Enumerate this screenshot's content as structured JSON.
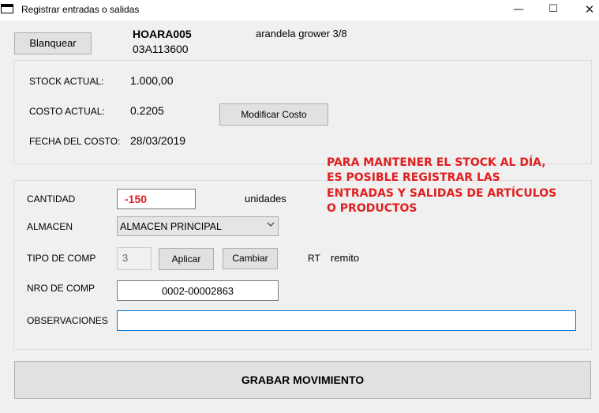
{
  "window": {
    "title": "Registrar entradas o salidas",
    "minimize_glyph": "—",
    "maximize_glyph": "☐",
    "close_glyph": "✕"
  },
  "header": {
    "clear_button": "Blanquear",
    "code": "HOARA005",
    "subcode": "03A113600",
    "description": "arandela grower 3/8"
  },
  "stock": {
    "stock_label": "STOCK ACTUAL:",
    "stock_value": "1.000,00",
    "cost_label": "COSTO ACTUAL:",
    "cost_value": "0.2205",
    "modify_cost_button": "Modificar Costo",
    "cost_date_label": "FECHA DEL COSTO:",
    "cost_date_value": "28/03/2019"
  },
  "notice": {
    "lines": [
      "PARA MANTENER EL STOCK AL DÍA,",
      "ES POSIBLE REGISTRAR LAS",
      "ENTRADAS Y SALIDAS DE ARTÍCULOS",
      "O PRODUCTOS"
    ],
    "color": "#e02020"
  },
  "form": {
    "quantity_label": "CANTIDAD",
    "quantity_value": "-150",
    "quantity_unit": "unidades",
    "warehouse_label": "ALMACEN",
    "warehouse_value": "ALMACEN PRINCIPAL",
    "comp_type_label": "TIPO DE COMP",
    "comp_type_value": "3",
    "apply_button": "Aplicar",
    "change_button": "Cambiar",
    "comp_type_code": "RT",
    "comp_type_name": "remito",
    "comp_number_label": "NRO DE COMP",
    "comp_number_value": "0002-00002863",
    "observations_label": "OBSERVACIONES",
    "observations_value": ""
  },
  "footer": {
    "save_button": "GRABAR MOVIMIENTO"
  }
}
